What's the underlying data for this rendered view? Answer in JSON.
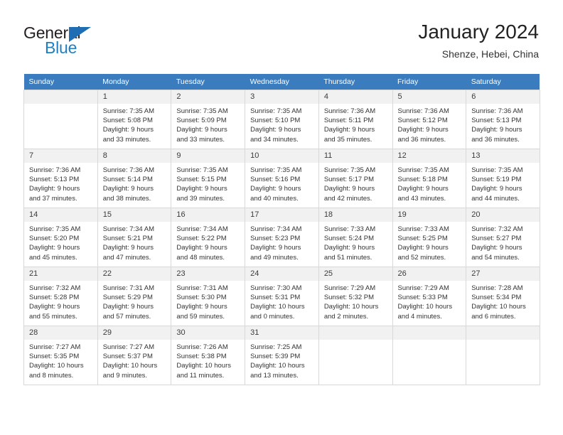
{
  "brand": {
    "name_top": "General",
    "name_bottom": "Blue",
    "triangle_color": "#1f6eb4",
    "text_color": "#231f20",
    "blue_color": "#1f7fc0",
    "logo_icon": "triangle-icon"
  },
  "header": {
    "title": "January 2024",
    "subtitle": "Shenze, Hebei, China",
    "accent_color": "#3a7cbe",
    "header_text_color": "#ffffff",
    "daynum_bg": "#f1f1f1",
    "grid_line_color": "#d8d8d8"
  },
  "weekday_headers": [
    "Sunday",
    "Monday",
    "Tuesday",
    "Wednesday",
    "Thursday",
    "Friday",
    "Saturday"
  ],
  "labels": {
    "sunrise_prefix": "Sunrise:",
    "sunset_prefix": "Sunset:",
    "daylight_prefix": "Daylight:"
  },
  "weeks": [
    [
      {
        "day": "",
        "sunrise": "",
        "sunset": "",
        "daylight": "",
        "empty": true
      },
      {
        "day": "1",
        "sunrise": "Sunrise: 7:35 AM",
        "sunset": "Sunset: 5:08 PM",
        "daylight": "Daylight: 9 hours and 33 minutes.",
        "empty": false
      },
      {
        "day": "2",
        "sunrise": "Sunrise: 7:35 AM",
        "sunset": "Sunset: 5:09 PM",
        "daylight": "Daylight: 9 hours and 33 minutes.",
        "empty": false
      },
      {
        "day": "3",
        "sunrise": "Sunrise: 7:35 AM",
        "sunset": "Sunset: 5:10 PM",
        "daylight": "Daylight: 9 hours and 34 minutes.",
        "empty": false
      },
      {
        "day": "4",
        "sunrise": "Sunrise: 7:36 AM",
        "sunset": "Sunset: 5:11 PM",
        "daylight": "Daylight: 9 hours and 35 minutes.",
        "empty": false
      },
      {
        "day": "5",
        "sunrise": "Sunrise: 7:36 AM",
        "sunset": "Sunset: 5:12 PM",
        "daylight": "Daylight: 9 hours and 36 minutes.",
        "empty": false
      },
      {
        "day": "6",
        "sunrise": "Sunrise: 7:36 AM",
        "sunset": "Sunset: 5:13 PM",
        "daylight": "Daylight: 9 hours and 36 minutes.",
        "empty": false
      }
    ],
    [
      {
        "day": "7",
        "sunrise": "Sunrise: 7:36 AM",
        "sunset": "Sunset: 5:13 PM",
        "daylight": "Daylight: 9 hours and 37 minutes.",
        "empty": false
      },
      {
        "day": "8",
        "sunrise": "Sunrise: 7:36 AM",
        "sunset": "Sunset: 5:14 PM",
        "daylight": "Daylight: 9 hours and 38 minutes.",
        "empty": false
      },
      {
        "day": "9",
        "sunrise": "Sunrise: 7:35 AM",
        "sunset": "Sunset: 5:15 PM",
        "daylight": "Daylight: 9 hours and 39 minutes.",
        "empty": false
      },
      {
        "day": "10",
        "sunrise": "Sunrise: 7:35 AM",
        "sunset": "Sunset: 5:16 PM",
        "daylight": "Daylight: 9 hours and 40 minutes.",
        "empty": false
      },
      {
        "day": "11",
        "sunrise": "Sunrise: 7:35 AM",
        "sunset": "Sunset: 5:17 PM",
        "daylight": "Daylight: 9 hours and 42 minutes.",
        "empty": false
      },
      {
        "day": "12",
        "sunrise": "Sunrise: 7:35 AM",
        "sunset": "Sunset: 5:18 PM",
        "daylight": "Daylight: 9 hours and 43 minutes.",
        "empty": false
      },
      {
        "day": "13",
        "sunrise": "Sunrise: 7:35 AM",
        "sunset": "Sunset: 5:19 PM",
        "daylight": "Daylight: 9 hours and 44 minutes.",
        "empty": false
      }
    ],
    [
      {
        "day": "14",
        "sunrise": "Sunrise: 7:35 AM",
        "sunset": "Sunset: 5:20 PM",
        "daylight": "Daylight: 9 hours and 45 minutes.",
        "empty": false
      },
      {
        "day": "15",
        "sunrise": "Sunrise: 7:34 AM",
        "sunset": "Sunset: 5:21 PM",
        "daylight": "Daylight: 9 hours and 47 minutes.",
        "empty": false
      },
      {
        "day": "16",
        "sunrise": "Sunrise: 7:34 AM",
        "sunset": "Sunset: 5:22 PM",
        "daylight": "Daylight: 9 hours and 48 minutes.",
        "empty": false
      },
      {
        "day": "17",
        "sunrise": "Sunrise: 7:34 AM",
        "sunset": "Sunset: 5:23 PM",
        "daylight": "Daylight: 9 hours and 49 minutes.",
        "empty": false
      },
      {
        "day": "18",
        "sunrise": "Sunrise: 7:33 AM",
        "sunset": "Sunset: 5:24 PM",
        "daylight": "Daylight: 9 hours and 51 minutes.",
        "empty": false
      },
      {
        "day": "19",
        "sunrise": "Sunrise: 7:33 AM",
        "sunset": "Sunset: 5:25 PM",
        "daylight": "Daylight: 9 hours and 52 minutes.",
        "empty": false
      },
      {
        "day": "20",
        "sunrise": "Sunrise: 7:32 AM",
        "sunset": "Sunset: 5:27 PM",
        "daylight": "Daylight: 9 hours and 54 minutes.",
        "empty": false
      }
    ],
    [
      {
        "day": "21",
        "sunrise": "Sunrise: 7:32 AM",
        "sunset": "Sunset: 5:28 PM",
        "daylight": "Daylight: 9 hours and 55 minutes.",
        "empty": false
      },
      {
        "day": "22",
        "sunrise": "Sunrise: 7:31 AM",
        "sunset": "Sunset: 5:29 PM",
        "daylight": "Daylight: 9 hours and 57 minutes.",
        "empty": false
      },
      {
        "day": "23",
        "sunrise": "Sunrise: 7:31 AM",
        "sunset": "Sunset: 5:30 PM",
        "daylight": "Daylight: 9 hours and 59 minutes.",
        "empty": false
      },
      {
        "day": "24",
        "sunrise": "Sunrise: 7:30 AM",
        "sunset": "Sunset: 5:31 PM",
        "daylight": "Daylight: 10 hours and 0 minutes.",
        "empty": false
      },
      {
        "day": "25",
        "sunrise": "Sunrise: 7:29 AM",
        "sunset": "Sunset: 5:32 PM",
        "daylight": "Daylight: 10 hours and 2 minutes.",
        "empty": false
      },
      {
        "day": "26",
        "sunrise": "Sunrise: 7:29 AM",
        "sunset": "Sunset: 5:33 PM",
        "daylight": "Daylight: 10 hours and 4 minutes.",
        "empty": false
      },
      {
        "day": "27",
        "sunrise": "Sunrise: 7:28 AM",
        "sunset": "Sunset: 5:34 PM",
        "daylight": "Daylight: 10 hours and 6 minutes.",
        "empty": false
      }
    ],
    [
      {
        "day": "28",
        "sunrise": "Sunrise: 7:27 AM",
        "sunset": "Sunset: 5:35 PM",
        "daylight": "Daylight: 10 hours and 8 minutes.",
        "empty": false
      },
      {
        "day": "29",
        "sunrise": "Sunrise: 7:27 AM",
        "sunset": "Sunset: 5:37 PM",
        "daylight": "Daylight: 10 hours and 9 minutes.",
        "empty": false
      },
      {
        "day": "30",
        "sunrise": "Sunrise: 7:26 AM",
        "sunset": "Sunset: 5:38 PM",
        "daylight": "Daylight: 10 hours and 11 minutes.",
        "empty": false
      },
      {
        "day": "31",
        "sunrise": "Sunrise: 7:25 AM",
        "sunset": "Sunset: 5:39 PM",
        "daylight": "Daylight: 10 hours and 13 minutes.",
        "empty": false
      },
      {
        "day": "",
        "sunrise": "",
        "sunset": "",
        "daylight": "",
        "empty": true
      },
      {
        "day": "",
        "sunrise": "",
        "sunset": "",
        "daylight": "",
        "empty": true
      },
      {
        "day": "",
        "sunrise": "",
        "sunset": "",
        "daylight": "",
        "empty": true
      }
    ]
  ]
}
